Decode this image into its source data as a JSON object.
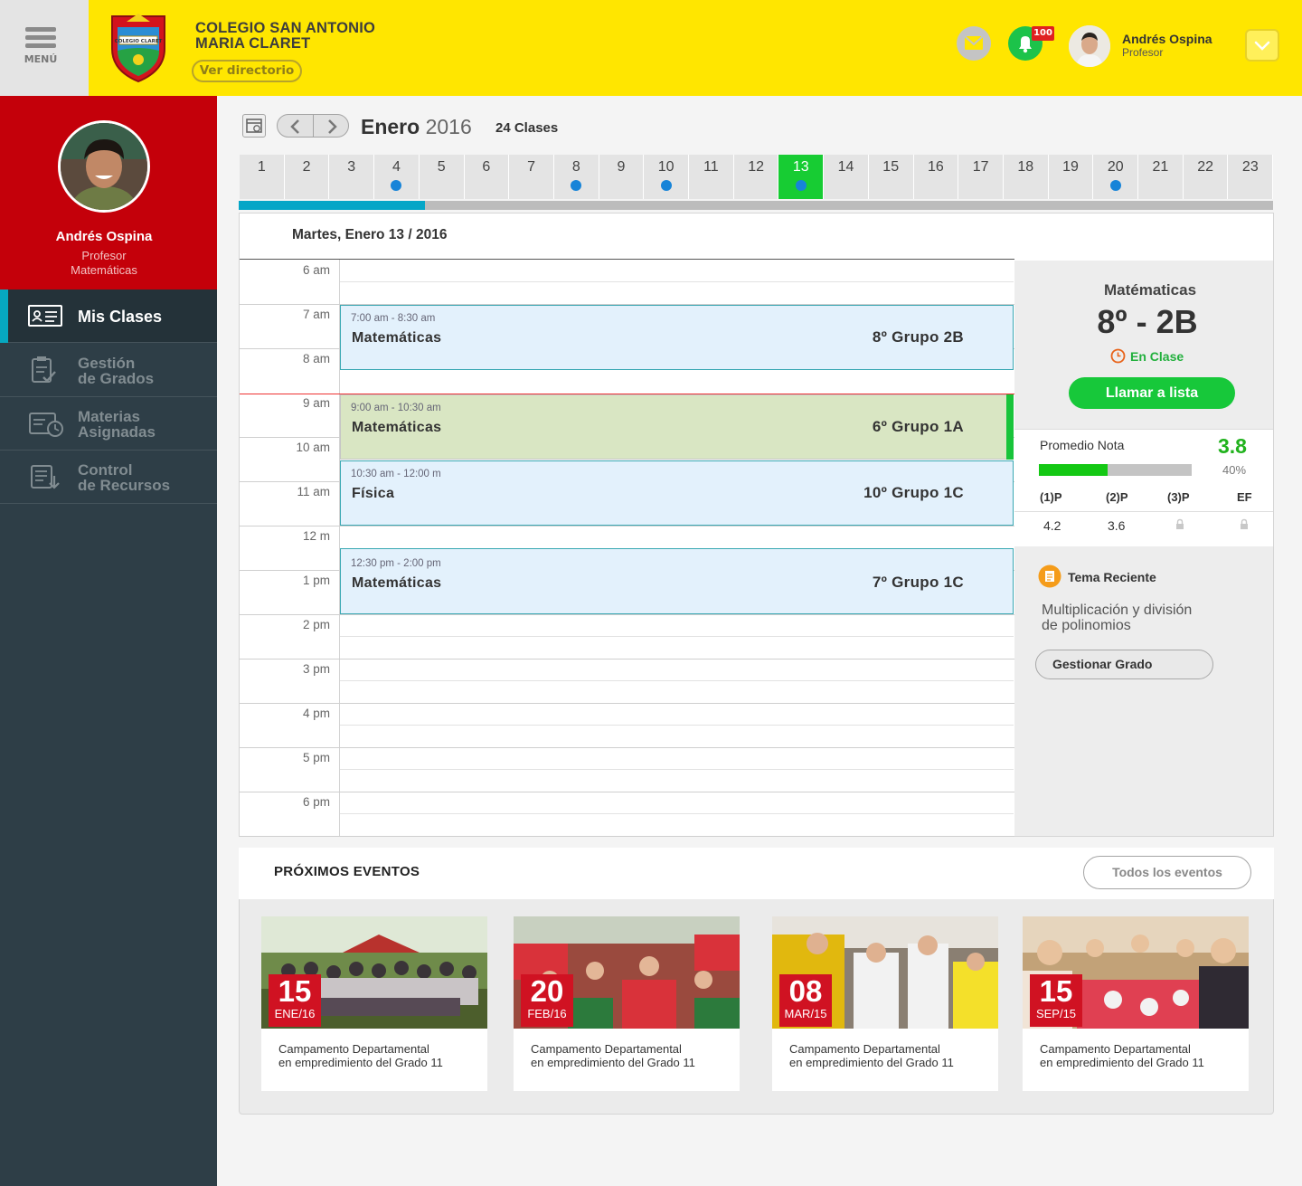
{
  "header": {
    "menu_label": "MENÚ",
    "school_name_line1": "COLEGIO SAN ANTONIO",
    "school_name_line2": "MARIA CLARET",
    "logo_text": "COLEGIO CLARET",
    "directory_button": "Ver directorio",
    "notifications_count": "100",
    "user": {
      "name": "Andrés Ospina",
      "role": "Profesor"
    }
  },
  "sidebar": {
    "profile": {
      "name": "Andrés Ospina",
      "role": "Profesor",
      "subject": "Matemáticas"
    },
    "items": [
      {
        "label": "Mis Clases",
        "active": true,
        "icon": "id-card-icon"
      },
      {
        "label_line1": "Gestión",
        "label_line2": "de Grados",
        "active": false,
        "icon": "clipboard-check-icon"
      },
      {
        "label_line1": "Materias",
        "label_line2": "Asignadas",
        "active": false,
        "icon": "book-clock-icon"
      },
      {
        "label_line1": "Control",
        "label_line2": "de Recursos",
        "active": false,
        "icon": "resources-icon"
      }
    ]
  },
  "calendar": {
    "month": "Enero",
    "year": "2016",
    "classes_count": "24 Clases",
    "days": [
      {
        "n": "1",
        "dot": false
      },
      {
        "n": "2",
        "dot": false
      },
      {
        "n": "3",
        "dot": false
      },
      {
        "n": "4",
        "dot": true
      },
      {
        "n": "5",
        "dot": false
      },
      {
        "n": "6",
        "dot": false
      },
      {
        "n": "7",
        "dot": false
      },
      {
        "n": "8",
        "dot": true
      },
      {
        "n": "9",
        "dot": false
      },
      {
        "n": "10",
        "dot": true
      },
      {
        "n": "11",
        "dot": false
      },
      {
        "n": "12",
        "dot": false
      },
      {
        "n": "13",
        "dot": true,
        "selected": true
      },
      {
        "n": "14",
        "dot": false
      },
      {
        "n": "15",
        "dot": false
      },
      {
        "n": "16",
        "dot": false
      },
      {
        "n": "17",
        "dot": false
      },
      {
        "n": "18",
        "dot": false
      },
      {
        "n": "19",
        "dot": false
      },
      {
        "n": "20",
        "dot": true
      },
      {
        "n": "21",
        "dot": false
      },
      {
        "n": "22",
        "dot": false
      },
      {
        "n": "23",
        "dot": false
      }
    ],
    "month_progress": 0.18,
    "colors": {
      "selected": "#17cc33",
      "dot": "#1784d8",
      "progress": "#05a6c7"
    }
  },
  "schedule": {
    "date_title": "Martes, Enero 13 / 2016",
    "hours": [
      "6 am",
      "7 am",
      "8 am",
      "9 am",
      "10 am",
      "11 am",
      "12 m",
      "1 pm",
      "2 pm",
      "3 pm",
      "4 pm",
      "5 pm",
      "6 pm"
    ],
    "events": [
      {
        "time": "7:00 am - 8:30 am",
        "subject": "Matemáticas",
        "group": "8º  Grupo 2B",
        "current": false
      },
      {
        "time": "9:00 am - 10:30 am",
        "subject": "Matemáticas",
        "group": "6º  Grupo 1A",
        "current": true
      },
      {
        "time": "10:30 am - 12:00 m",
        "subject": "Física",
        "group": "10º Grupo 1C",
        "current": false
      },
      {
        "time": "12:30 pm - 2:00 pm",
        "subject": "Matemáticas",
        "group": "7º  Grupo 1C",
        "current": false
      }
    ]
  },
  "class_info": {
    "subject": "Matématicas",
    "group": "8º - 2B",
    "status": "En Clase",
    "call_list_button": "Llamar a lista",
    "average_label": "Promedio Nota",
    "average_value": "3.8",
    "average_percent": "40%",
    "average_progress": 0.45,
    "grade_headers": [
      "(1)P",
      "(2)P",
      "(3)P",
      "EF"
    ],
    "grade_values": [
      "4.2",
      "3.6"
    ],
    "recent_topic_label": "Tema Reciente",
    "recent_topic_line1": "Multiplicación y división",
    "recent_topic_line2": "de polinomios",
    "manage_button": "Gestionar Grado"
  },
  "events": {
    "title": "PRÓXIMOS EVENTOS",
    "all_button": "Todos los eventos",
    "items": [
      {
        "day": "15",
        "month": "ENE/16",
        "line1": "Campamento Departamental",
        "line2": "en empredimiento del Grado 11"
      },
      {
        "day": "20",
        "month": "FEB/16",
        "line1": "Campamento Departamental",
        "line2": "en empredimiento del Grado 11"
      },
      {
        "day": "08",
        "month": "MAR/15",
        "line1": "Campamento Departamental",
        "line2": "en empredimiento del Grado 11"
      },
      {
        "day": "15",
        "month": "SEP/15",
        "line1": "Campamento Departamental",
        "line2": "en empredimiento del Grado 11"
      }
    ]
  }
}
